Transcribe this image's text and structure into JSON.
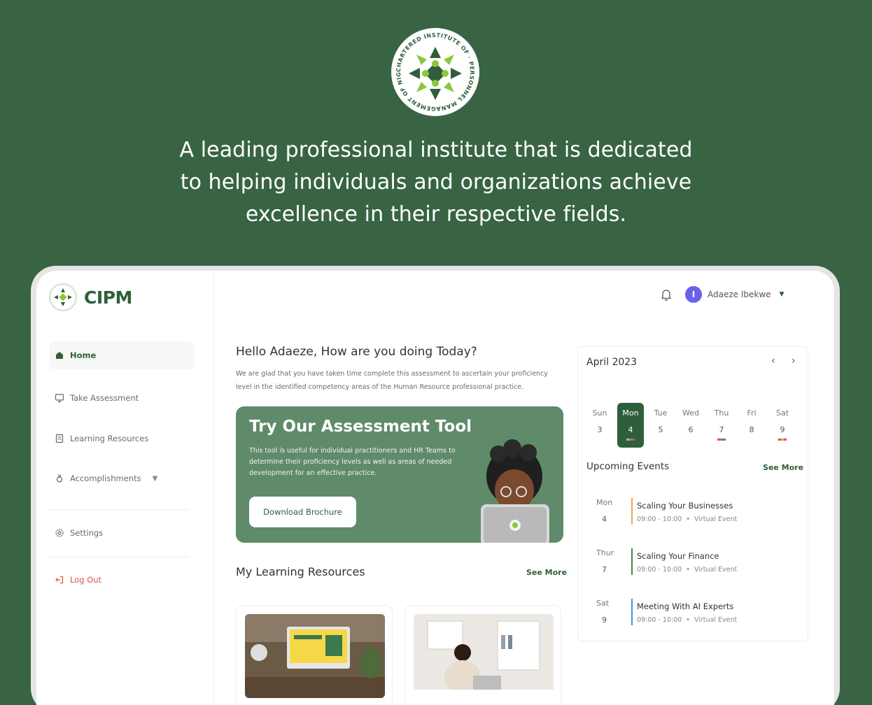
{
  "hero": {
    "tagline_line1": "A leading professional institute that is dedicated",
    "tagline_line2": "to helping individuals and organizations achieve",
    "tagline_line3": "excellence in their respective fields.",
    "seal_text": "CHARTERED INSTITUTE OF PERSONNEL MANAGEMENT OF NIGERIA"
  },
  "brand": {
    "name": "CIPM"
  },
  "sidebar": {
    "items": [
      {
        "label": "Home",
        "icon": "home-icon"
      },
      {
        "label": "Take Assessment",
        "icon": "monitor-icon"
      },
      {
        "label": "Learning Resources",
        "icon": "book-icon"
      },
      {
        "label": "Accomplishments",
        "icon": "award-icon"
      },
      {
        "label": "Settings",
        "icon": "gear-icon"
      },
      {
        "label": "Log Out",
        "icon": "logout-icon"
      }
    ]
  },
  "topbar": {
    "user_initial": "I",
    "user_name": "Adaeze Ibekwe"
  },
  "main": {
    "greeting": "Hello Adaeze, How are you doing Today?",
    "greeting_sub": "We are glad that you have taken time complete this assessment to ascertain your proficiency level in the identified competency areas of the Human Resource professional practice.",
    "promo": {
      "title": "Try Our Assessment Tool",
      "text": "This tool is useful for individual practitioners and HR Teams to determine their proficiency levels as well as areas of needed development for an effective practice.",
      "button": "Download Brochure"
    },
    "resources_title": "My Learning Resources",
    "resources_see_more": "See More"
  },
  "calendar": {
    "month": "April 2023",
    "days": [
      {
        "name": "Sun",
        "num": "3"
      },
      {
        "name": "Mon",
        "num": "4"
      },
      {
        "name": "Tue",
        "num": "5"
      },
      {
        "name": "Wed",
        "num": "6"
      },
      {
        "name": "Thu",
        "num": "7"
      },
      {
        "name": "Fri",
        "num": "8"
      },
      {
        "name": "Sat",
        "num": "9"
      }
    ],
    "events_title": "Upcoming Events",
    "events_see_more": "See More",
    "events": [
      {
        "day": "Mon",
        "date": "4",
        "title": "Scaling Your Businesses",
        "time": "09:00 - 10:00",
        "type": "Virtual Event",
        "color": "#f0a35e"
      },
      {
        "day": "Thur",
        "date": "7",
        "title": "Scaling Your Finance",
        "time": "09:00 - 10:00",
        "type": "Virtual Event",
        "color": "#3d8b4f"
      },
      {
        "day": "Sat",
        "date": "9",
        "title": "Meeting With AI Experts",
        "time": "09:00 - 10:00",
        "type": "Virtual Event",
        "color": "#4a90d9"
      }
    ]
  },
  "colors": {
    "brand_green": "#2f5f3a",
    "hero_bg": "#386443",
    "promo_bg": "#5f8b6a",
    "avatar": "#6b62e8",
    "logout": "#d9534f"
  }
}
